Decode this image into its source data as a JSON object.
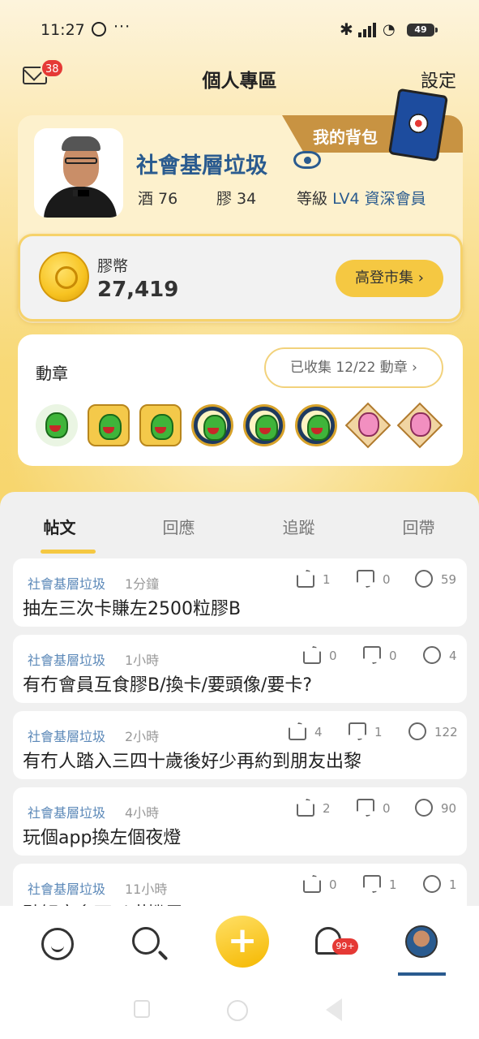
{
  "status": {
    "time": "11:27",
    "dots": "···",
    "battery": "49"
  },
  "header": {
    "mail_badge": "38",
    "title": "個人專區",
    "settings": "設定"
  },
  "profile": {
    "backpack": "我的背包",
    "name": "社會基層垃圾",
    "wine_label": "酒 76",
    "glue_label": "膠 34",
    "level_label": "等級",
    "level_value": "LV4 資深會員"
  },
  "coins": {
    "label": "膠幣",
    "value": "27,419",
    "market": "高登市集 ›"
  },
  "medals": {
    "title": "動章",
    "collected": "已收集 12/22 動章 ›"
  },
  "tabs": [
    "帖文",
    "回應",
    "追蹤",
    "回帶"
  ],
  "posts": [
    {
      "author": "社會基層垃圾",
      "ago": "1分鐘",
      "likes": "1",
      "dislikes": "0",
      "comments": "59",
      "title": "抽左三次卡賺左2500粒膠B"
    },
    {
      "author": "社會基層垃圾",
      "ago": "1小時",
      "likes": "0",
      "dislikes": "0",
      "comments": "4",
      "title": "有冇會員互食膠B/換卡/要頭像/要卡?"
    },
    {
      "author": "社會基層垃圾",
      "ago": "2小時",
      "likes": "4",
      "dislikes": "1",
      "comments": "122",
      "title": "有冇人踏入三四十歲後好少再約到朋友出黎"
    },
    {
      "author": "社會基層垃圾",
      "ago": "4小時",
      "likes": "2",
      "dislikes": "0",
      "comments": "90",
      "title": "玩個app換左個夜燈"
    },
    {
      "author": "社會基層垃圾",
      "ago": "11小時",
      "likes": "0",
      "dislikes": "1",
      "comments": "1",
      "title": "點解突多可以咁機電?"
    }
  ],
  "nav": {
    "bell_badge": "99+",
    "add": "+"
  },
  "colors": {
    "accent": "#f5c842",
    "link": "#2a5b8f",
    "badge": "#e53935"
  }
}
